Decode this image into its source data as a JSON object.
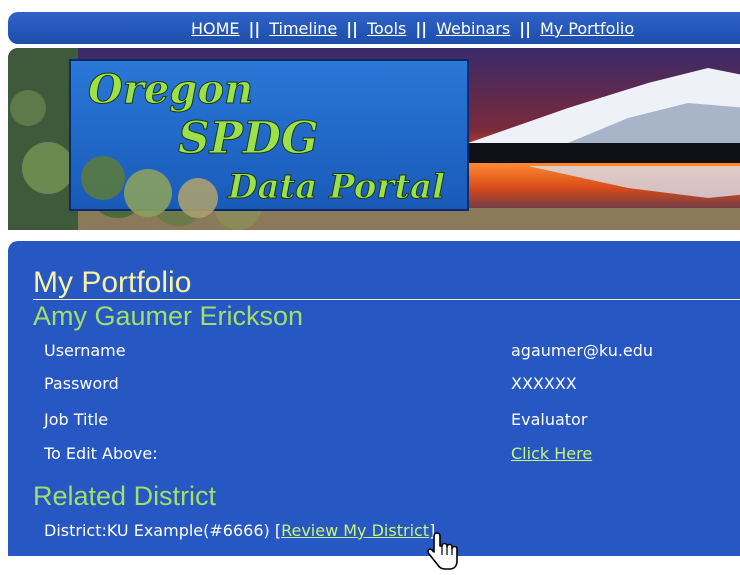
{
  "nav": {
    "items": [
      "HOME",
      "Timeline",
      "Tools",
      "Webinars",
      "My Portfolio"
    ],
    "separator": "||"
  },
  "banner": {
    "line1": "Oregon",
    "line2": "SPDG",
    "line3": "Data Portal"
  },
  "main": {
    "title": "My Portfolio",
    "name": "Amy Gaumer Erickson",
    "fields": [
      {
        "label": "Username",
        "value": "agaumer@ku.edu"
      },
      {
        "label": "Password",
        "value": "XXXXXX"
      },
      {
        "label": "Job Title",
        "value": "Evaluator"
      },
      {
        "label": "To Edit Above:",
        "value": "Click Here"
      }
    ],
    "related_title": "Related District",
    "district_text": "District:KU Example(#6666) ",
    "district_bracket_open": "[",
    "review_link": "Review My District",
    "district_bracket_close": "]"
  },
  "colors": {
    "nav_bg": "#2456b8",
    "panel_bg": "#2657c2",
    "title_yellow": "#f7f1a4",
    "name_green": "#9fe06a",
    "link_green": "#c8f37a"
  },
  "icons": [
    "hand-pointer-cursor-icon"
  ]
}
